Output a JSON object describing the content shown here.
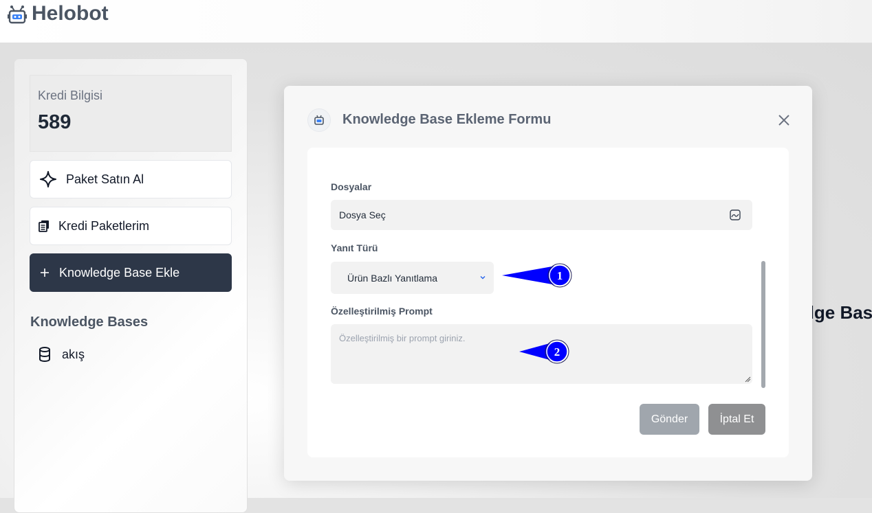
{
  "app": {
    "title": "Helobot",
    "logo_icon": "robot-icon"
  },
  "sidebar": {
    "credit": {
      "label": "Kredi Bilgisi",
      "value": "589"
    },
    "buttons": [
      {
        "label": "Paket Satın Al",
        "icon": "sparkle-icon"
      },
      {
        "label": "Kredi Paketlerim",
        "icon": "documents-icon"
      },
      {
        "label": "Knowledge Base Ekle",
        "icon": "plus-icon"
      }
    ],
    "kb_heading": "Knowledge Bases",
    "kb_items": [
      {
        "label": "akış",
        "icon": "database-icon"
      }
    ]
  },
  "background": {
    "partial_heading": "dge Bas"
  },
  "modal": {
    "title": "Knowledge Base Ekleme Formu",
    "icon": "robot-icon",
    "files_label": "Dosyalar",
    "files_value": "Dosya Seç",
    "response_type_label": "Yanıt Türü",
    "response_type_value": "Ürün Bazlı Yanıtlama",
    "prompt_label": "Özelleştirilmiş Prompt",
    "prompt_placeholder": "Özelleştirilmiş bir prompt giriniz.",
    "submit_label": "Gönder",
    "cancel_label": "İptal Et"
  },
  "annotations": [
    {
      "label": "1"
    },
    {
      "label": "2"
    }
  ],
  "colors": {
    "primary_dark": "#2d3748",
    "annotation": "#0000ff",
    "submit_disabled": "#a0a6ad",
    "cancel": "#8f9092"
  }
}
